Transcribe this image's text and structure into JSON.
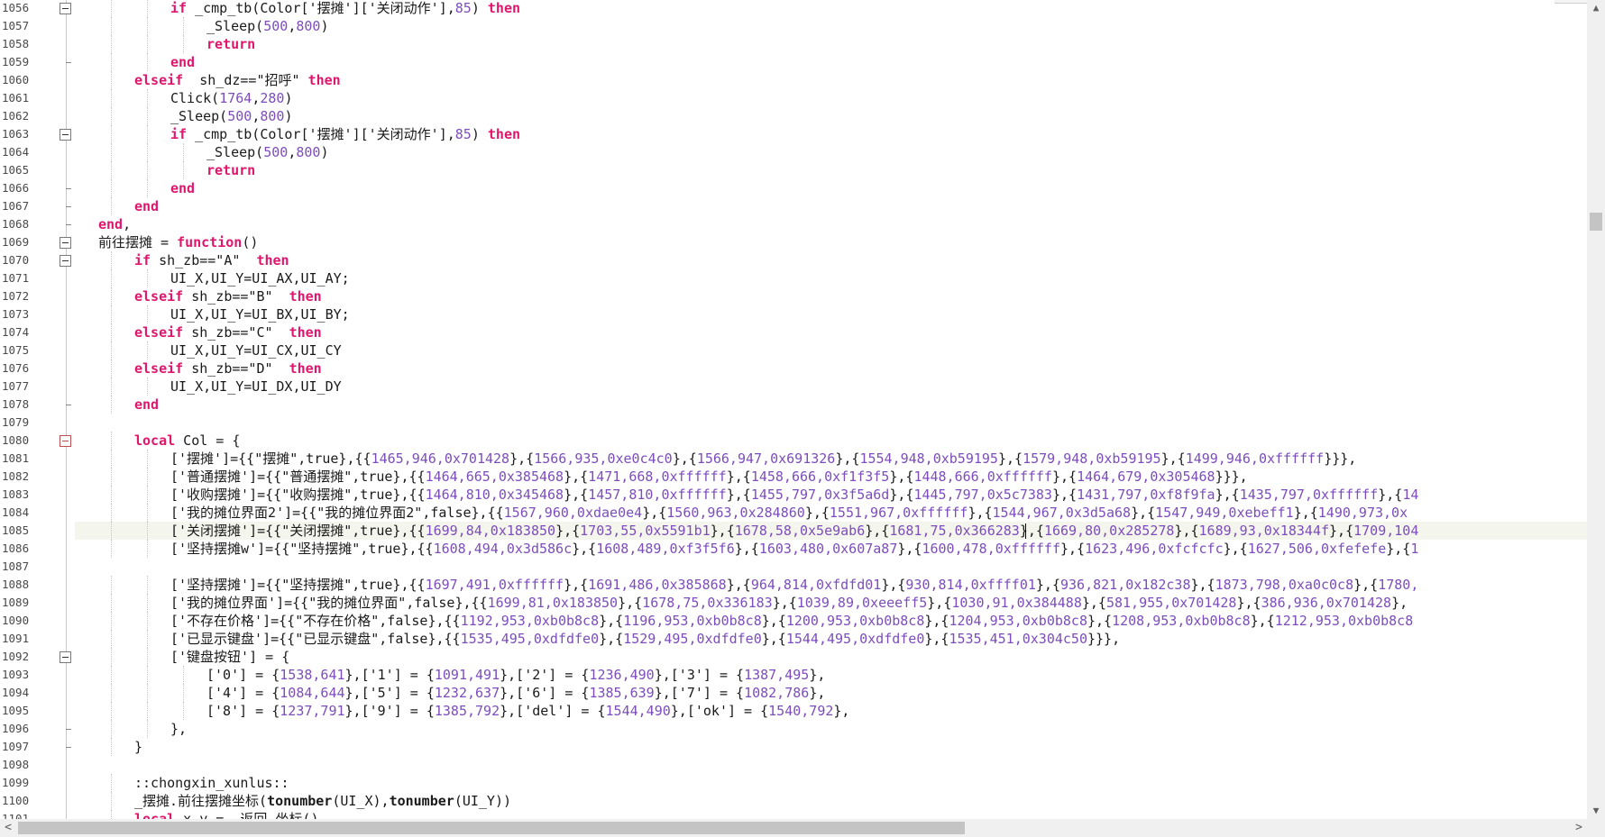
{
  "editor": {
    "current_line": "1085",
    "scrollbar_vertical": {
      "up_arrow": "▲",
      "down_arrow": "▼"
    },
    "scrollbar_horizontal": {
      "left_arrow": "<",
      "right_arrow": ">"
    },
    "lines": [
      {
        "n": "1056",
        "indent": 3,
        "fold": "box",
        "tokens": [
          [
            "k",
            "if"
          ],
          [
            "t",
            " _cmp_tb(Color['摆摊']['关闭动作'],"
          ],
          [
            "n",
            "85"
          ],
          [
            "t",
            ") "
          ],
          [
            "k",
            "then"
          ]
        ]
      },
      {
        "n": "1057",
        "indent": 4,
        "tokens": [
          [
            "t",
            "_Sleep("
          ],
          [
            "n",
            "500"
          ],
          [
            "t",
            ","
          ],
          [
            "n",
            "800"
          ],
          [
            "t",
            ")"
          ]
        ]
      },
      {
        "n": "1058",
        "indent": 4,
        "tokens": [
          [
            "k",
            "return"
          ]
        ]
      },
      {
        "n": "1059",
        "indent": 3,
        "fold": "end",
        "tokens": [
          [
            "k",
            "end"
          ]
        ]
      },
      {
        "n": "1060",
        "indent": 2,
        "tokens": [
          [
            "k",
            "elseif"
          ],
          [
            "t",
            "  sh_dz==\"招呼\" "
          ],
          [
            "k",
            "then"
          ]
        ]
      },
      {
        "n": "1061",
        "indent": 3,
        "tokens": [
          [
            "t",
            "Click("
          ],
          [
            "n",
            "1764"
          ],
          [
            "t",
            ","
          ],
          [
            "n",
            "280"
          ],
          [
            "t",
            ")"
          ]
        ]
      },
      {
        "n": "1062",
        "indent": 3,
        "tokens": [
          [
            "t",
            "_Sleep("
          ],
          [
            "n",
            "500"
          ],
          [
            "t",
            ","
          ],
          [
            "n",
            "800"
          ],
          [
            "t",
            ")"
          ]
        ]
      },
      {
        "n": "1063",
        "indent": 3,
        "fold": "box",
        "tokens": [
          [
            "k",
            "if"
          ],
          [
            "t",
            " _cmp_tb(Color['摆摊']['关闭动作'],"
          ],
          [
            "n",
            "85"
          ],
          [
            "t",
            ") "
          ],
          [
            "k",
            "then"
          ]
        ]
      },
      {
        "n": "1064",
        "indent": 4,
        "tokens": [
          [
            "t",
            "_Sleep("
          ],
          [
            "n",
            "500"
          ],
          [
            "t",
            ","
          ],
          [
            "n",
            "800"
          ],
          [
            "t",
            ")"
          ]
        ]
      },
      {
        "n": "1065",
        "indent": 4,
        "tokens": [
          [
            "k",
            "return"
          ]
        ]
      },
      {
        "n": "1066",
        "indent": 3,
        "fold": "end",
        "tokens": [
          [
            "k",
            "end"
          ]
        ]
      },
      {
        "n": "1067",
        "indent": 2,
        "fold": "end",
        "tokens": [
          [
            "k",
            "end"
          ]
        ]
      },
      {
        "n": "1068",
        "indent": 1,
        "fold": "end",
        "tokens": [
          [
            "k",
            "end"
          ],
          [
            "t",
            ","
          ]
        ]
      },
      {
        "n": "1069",
        "indent": 1,
        "fold": "box",
        "tokens": [
          [
            "t",
            "前往摆摊 = "
          ],
          [
            "k",
            "function"
          ],
          [
            "t",
            "()"
          ]
        ]
      },
      {
        "n": "1070",
        "indent": 2,
        "fold": "box",
        "tokens": [
          [
            "k",
            "if"
          ],
          [
            "t",
            " sh_zb==\"A\"  "
          ],
          [
            "k",
            "then"
          ]
        ]
      },
      {
        "n": "1071",
        "indent": 3,
        "tokens": [
          [
            "t",
            "UI_X,UI_Y=UI_AX,UI_AY;"
          ]
        ]
      },
      {
        "n": "1072",
        "indent": 2,
        "tokens": [
          [
            "k",
            "elseif"
          ],
          [
            "t",
            " sh_zb==\"B\"  "
          ],
          [
            "k",
            "then"
          ]
        ]
      },
      {
        "n": "1073",
        "indent": 3,
        "tokens": [
          [
            "t",
            "UI_X,UI_Y=UI_BX,UI_BY;"
          ]
        ]
      },
      {
        "n": "1074",
        "indent": 2,
        "tokens": [
          [
            "k",
            "elseif"
          ],
          [
            "t",
            " sh_zb==\"C\"  "
          ],
          [
            "k",
            "then"
          ]
        ]
      },
      {
        "n": "1075",
        "indent": 3,
        "tokens": [
          [
            "t",
            "UI_X,UI_Y=UI_CX,UI_CY"
          ]
        ]
      },
      {
        "n": "1076",
        "indent": 2,
        "tokens": [
          [
            "k",
            "elseif"
          ],
          [
            "t",
            " sh_zb==\"D\"  "
          ],
          [
            "k",
            "then"
          ]
        ]
      },
      {
        "n": "1077",
        "indent": 3,
        "tokens": [
          [
            "t",
            "UI_X,UI_Y=UI_DX,UI_DY"
          ]
        ]
      },
      {
        "n": "1078",
        "indent": 2,
        "fold": "end",
        "tokens": [
          [
            "k",
            "end"
          ]
        ]
      },
      {
        "n": "1079",
        "indent": 0,
        "tokens": []
      },
      {
        "n": "1080",
        "indent": 2,
        "fold": "boxred",
        "tokens": [
          [
            "k",
            "local"
          ],
          [
            "t",
            " Col = {"
          ]
        ]
      },
      {
        "n": "1081",
        "indent": 3,
        "tokens": [
          [
            "t",
            "['摆摊']={{\"摆摊\",true},{{"
          ],
          [
            "n",
            "1465,946,0x701428"
          ],
          [
            "t",
            "},{"
          ],
          [
            "n",
            "1566,935,0xe0c4c0"
          ],
          [
            "t",
            "},{"
          ],
          [
            "n",
            "1566,947,0x691326"
          ],
          [
            "t",
            "},{"
          ],
          [
            "n",
            "1554,948,0xb59195"
          ],
          [
            "t",
            "},{"
          ],
          [
            "n",
            "1579,948,0xb59195"
          ],
          [
            "t",
            "},{"
          ],
          [
            "n",
            "1499,946,0xffffff"
          ],
          [
            "t",
            "}}},"
          ]
        ]
      },
      {
        "n": "1082",
        "indent": 3,
        "tokens": [
          [
            "t",
            "['普通摆摊']={{\"普通摆摊\",true},{{"
          ],
          [
            "n",
            "1464,665,0x385468"
          ],
          [
            "t",
            "},{"
          ],
          [
            "n",
            "1471,668,0xffffff"
          ],
          [
            "t",
            "},{"
          ],
          [
            "n",
            "1458,666,0xf1f3f5"
          ],
          [
            "t",
            "},{"
          ],
          [
            "n",
            "1448,666,0xffffff"
          ],
          [
            "t",
            "},{"
          ],
          [
            "n",
            "1464,679,0x305468"
          ],
          [
            "t",
            "}}},"
          ]
        ]
      },
      {
        "n": "1083",
        "indent": 3,
        "tokens": [
          [
            "t",
            "['收购摆摊']={{\"收购摆摊\",true},{{"
          ],
          [
            "n",
            "1464,810,0x345468"
          ],
          [
            "t",
            "},{"
          ],
          [
            "n",
            "1457,810,0xffffff"
          ],
          [
            "t",
            "},{"
          ],
          [
            "n",
            "1455,797,0x3f5a6d"
          ],
          [
            "t",
            "},{"
          ],
          [
            "n",
            "1445,797,0x5c7383"
          ],
          [
            "t",
            "},{"
          ],
          [
            "n",
            "1431,797,0xf8f9fa"
          ],
          [
            "t",
            "},{"
          ],
          [
            "n",
            "1435,797,0xffffff"
          ],
          [
            "t",
            "},{"
          ],
          [
            "n",
            "14"
          ]
        ]
      },
      {
        "n": "1084",
        "indent": 3,
        "tokens": [
          [
            "t",
            "['我的摊位界面2']={{\"我的摊位界面2\",false},{{"
          ],
          [
            "n",
            "1567,960,0xdae0e4"
          ],
          [
            "t",
            "},{"
          ],
          [
            "n",
            "1560,963,0x284860"
          ],
          [
            "t",
            "},{"
          ],
          [
            "n",
            "1551,967,0xffffff"
          ],
          [
            "t",
            "},{"
          ],
          [
            "n",
            "1544,967,0x3d5a68"
          ],
          [
            "t",
            "},{"
          ],
          [
            "n",
            "1547,949,0xebeff1"
          ],
          [
            "t",
            "},{"
          ],
          [
            "n",
            "1490,973,0x"
          ]
        ]
      },
      {
        "n": "1085",
        "indent": 3,
        "current": true,
        "tokens": [
          [
            "t",
            "['关闭摆摊']={{\"关闭摆摊\",true},{{"
          ],
          [
            "n",
            "1699,84,0x183850"
          ],
          [
            "t",
            "},{"
          ],
          [
            "n",
            "1703,55,0x5591b1"
          ],
          [
            "t",
            "},{"
          ],
          [
            "n",
            "1678,58,0x5e9ab6"
          ],
          [
            "t",
            "},{"
          ],
          [
            "n",
            "1681,75,0x366283"
          ],
          [
            "t",
            "},{"
          ],
          [
            "n",
            "1669,80,0x285278"
          ],
          [
            "t",
            "},{"
          ],
          [
            "n",
            "1689,93,0x18344f"
          ],
          [
            "t",
            "},{"
          ],
          [
            "n",
            "1709,104"
          ]
        ]
      },
      {
        "n": "1086",
        "indent": 3,
        "tokens": [
          [
            "t",
            "['坚持摆摊w']={{\"坚持摆摊\",true},{{"
          ],
          [
            "n",
            "1608,494,0x3d586c"
          ],
          [
            "t",
            "},{"
          ],
          [
            "n",
            "1608,489,0xf3f5f6"
          ],
          [
            "t",
            "},{"
          ],
          [
            "n",
            "1603,480,0x607a87"
          ],
          [
            "t",
            "},{"
          ],
          [
            "n",
            "1600,478,0xffffff"
          ],
          [
            "t",
            "},{"
          ],
          [
            "n",
            "1623,496,0xfcfcfc"
          ],
          [
            "t",
            "},{"
          ],
          [
            "n",
            "1627,506,0xfefefe"
          ],
          [
            "t",
            "},{"
          ],
          [
            "n",
            "1"
          ]
        ]
      },
      {
        "n": "1087",
        "indent": 0,
        "tokens": []
      },
      {
        "n": "1088",
        "indent": 3,
        "tokens": [
          [
            "t",
            "['坚持摆摊']={{\"坚持摆摊\",true},{{"
          ],
          [
            "n",
            "1697,491,0xffffff"
          ],
          [
            "t",
            "},{"
          ],
          [
            "n",
            "1691,486,0x385868"
          ],
          [
            "t",
            "},{"
          ],
          [
            "n",
            "964,814,0xfdfd01"
          ],
          [
            "t",
            "},{"
          ],
          [
            "n",
            "930,814,0xffff01"
          ],
          [
            "t",
            "},{"
          ],
          [
            "n",
            "936,821,0x182c38"
          ],
          [
            "t",
            "},{"
          ],
          [
            "n",
            "1873,798,0xa0c0c8"
          ],
          [
            "t",
            "},{"
          ],
          [
            "n",
            "1780,"
          ]
        ]
      },
      {
        "n": "1089",
        "indent": 3,
        "tokens": [
          [
            "t",
            "['我的摊位界面']={{\"我的摊位界面\",false},{{"
          ],
          [
            "n",
            "1699,81,0x183850"
          ],
          [
            "t",
            "},{"
          ],
          [
            "n",
            "1678,75,0x336183"
          ],
          [
            "t",
            "},{"
          ],
          [
            "n",
            "1039,89,0xeeeff5"
          ],
          [
            "t",
            "},{"
          ],
          [
            "n",
            "1030,91,0x384488"
          ],
          [
            "t",
            "},{"
          ],
          [
            "n",
            "581,955,0x701428"
          ],
          [
            "t",
            "},{"
          ],
          [
            "n",
            "386,936,0x701428"
          ],
          [
            "t",
            "},"
          ]
        ]
      },
      {
        "n": "1090",
        "indent": 3,
        "tokens": [
          [
            "t",
            "['不存在价格']={{\"不存在价格\",false},{{"
          ],
          [
            "n",
            "1192,953,0xb0b8c8"
          ],
          [
            "t",
            "},{"
          ],
          [
            "n",
            "1196,953,0xb0b8c8"
          ],
          [
            "t",
            "},{"
          ],
          [
            "n",
            "1200,953,0xb0b8c8"
          ],
          [
            "t",
            "},{"
          ],
          [
            "n",
            "1204,953,0xb0b8c8"
          ],
          [
            "t",
            "},{"
          ],
          [
            "n",
            "1208,953,0xb0b8c8"
          ],
          [
            "t",
            "},{"
          ],
          [
            "n",
            "1212,953,0xb0b8c8"
          ]
        ]
      },
      {
        "n": "1091",
        "indent": 3,
        "tokens": [
          [
            "t",
            "['已显示键盘']={{\"已显示键盘\",false},{{"
          ],
          [
            "n",
            "1535,495,0xdfdfe0"
          ],
          [
            "t",
            "},{"
          ],
          [
            "n",
            "1529,495,0xdfdfe0"
          ],
          [
            "t",
            "},{"
          ],
          [
            "n",
            "1544,495,0xdfdfe0"
          ],
          [
            "t",
            "},{"
          ],
          [
            "n",
            "1535,451,0x304c50"
          ],
          [
            "t",
            "}}},"
          ]
        ]
      },
      {
        "n": "1092",
        "indent": 3,
        "fold": "box",
        "tokens": [
          [
            "t",
            "['键盘按钮'] = {"
          ]
        ]
      },
      {
        "n": "1093",
        "indent": 4,
        "tokens": [
          [
            "t",
            "['0'] = {"
          ],
          [
            "n",
            "1538,641"
          ],
          [
            "t",
            "},['1'] = {"
          ],
          [
            "n",
            "1091,491"
          ],
          [
            "t",
            "},['2'] = {"
          ],
          [
            "n",
            "1236,490"
          ],
          [
            "t",
            "},['3'] = {"
          ],
          [
            "n",
            "1387,495"
          ],
          [
            "t",
            "},"
          ]
        ]
      },
      {
        "n": "1094",
        "indent": 4,
        "tokens": [
          [
            "t",
            "['4'] = {"
          ],
          [
            "n",
            "1084,644"
          ],
          [
            "t",
            "},['5'] = {"
          ],
          [
            "n",
            "1232,637"
          ],
          [
            "t",
            "},['6'] = {"
          ],
          [
            "n",
            "1385,639"
          ],
          [
            "t",
            "},['7'] = {"
          ],
          [
            "n",
            "1082,786"
          ],
          [
            "t",
            "},"
          ]
        ]
      },
      {
        "n": "1095",
        "indent": 4,
        "tokens": [
          [
            "t",
            "['8'] = {"
          ],
          [
            "n",
            "1237,791"
          ],
          [
            "t",
            "},['9'] = {"
          ],
          [
            "n",
            "1385,792"
          ],
          [
            "t",
            "},['del'] = {"
          ],
          [
            "n",
            "1544,490"
          ],
          [
            "t",
            "},['ok'] = {"
          ],
          [
            "n",
            "1540,792"
          ],
          [
            "t",
            "},"
          ]
        ]
      },
      {
        "n": "1096",
        "indent": 3,
        "fold": "end",
        "tokens": [
          [
            "t",
            "},"
          ]
        ]
      },
      {
        "n": "1097",
        "indent": 2,
        "fold": "end",
        "tokens": [
          [
            "t",
            "}"
          ]
        ]
      },
      {
        "n": "1098",
        "indent": 0,
        "tokens": []
      },
      {
        "n": "1099",
        "indent": 2,
        "tokens": [
          [
            "t",
            "::chongxin_xunlus::"
          ]
        ]
      },
      {
        "n": "1100",
        "indent": 2,
        "tokens": [
          [
            "t",
            "_摆摊.前往摆摊坐标("
          ],
          [
            "b",
            "tonumber"
          ],
          [
            "t",
            "(UI_X),"
          ],
          [
            "b",
            "tonumber"
          ],
          [
            "t",
            "(UI_Y))"
          ]
        ]
      },
      {
        "n": "1101",
        "indent": 2,
        "tokens": [
          [
            "k",
            "local"
          ],
          [
            "t",
            " x,y = _返回_坐标()"
          ]
        ]
      }
    ]
  }
}
